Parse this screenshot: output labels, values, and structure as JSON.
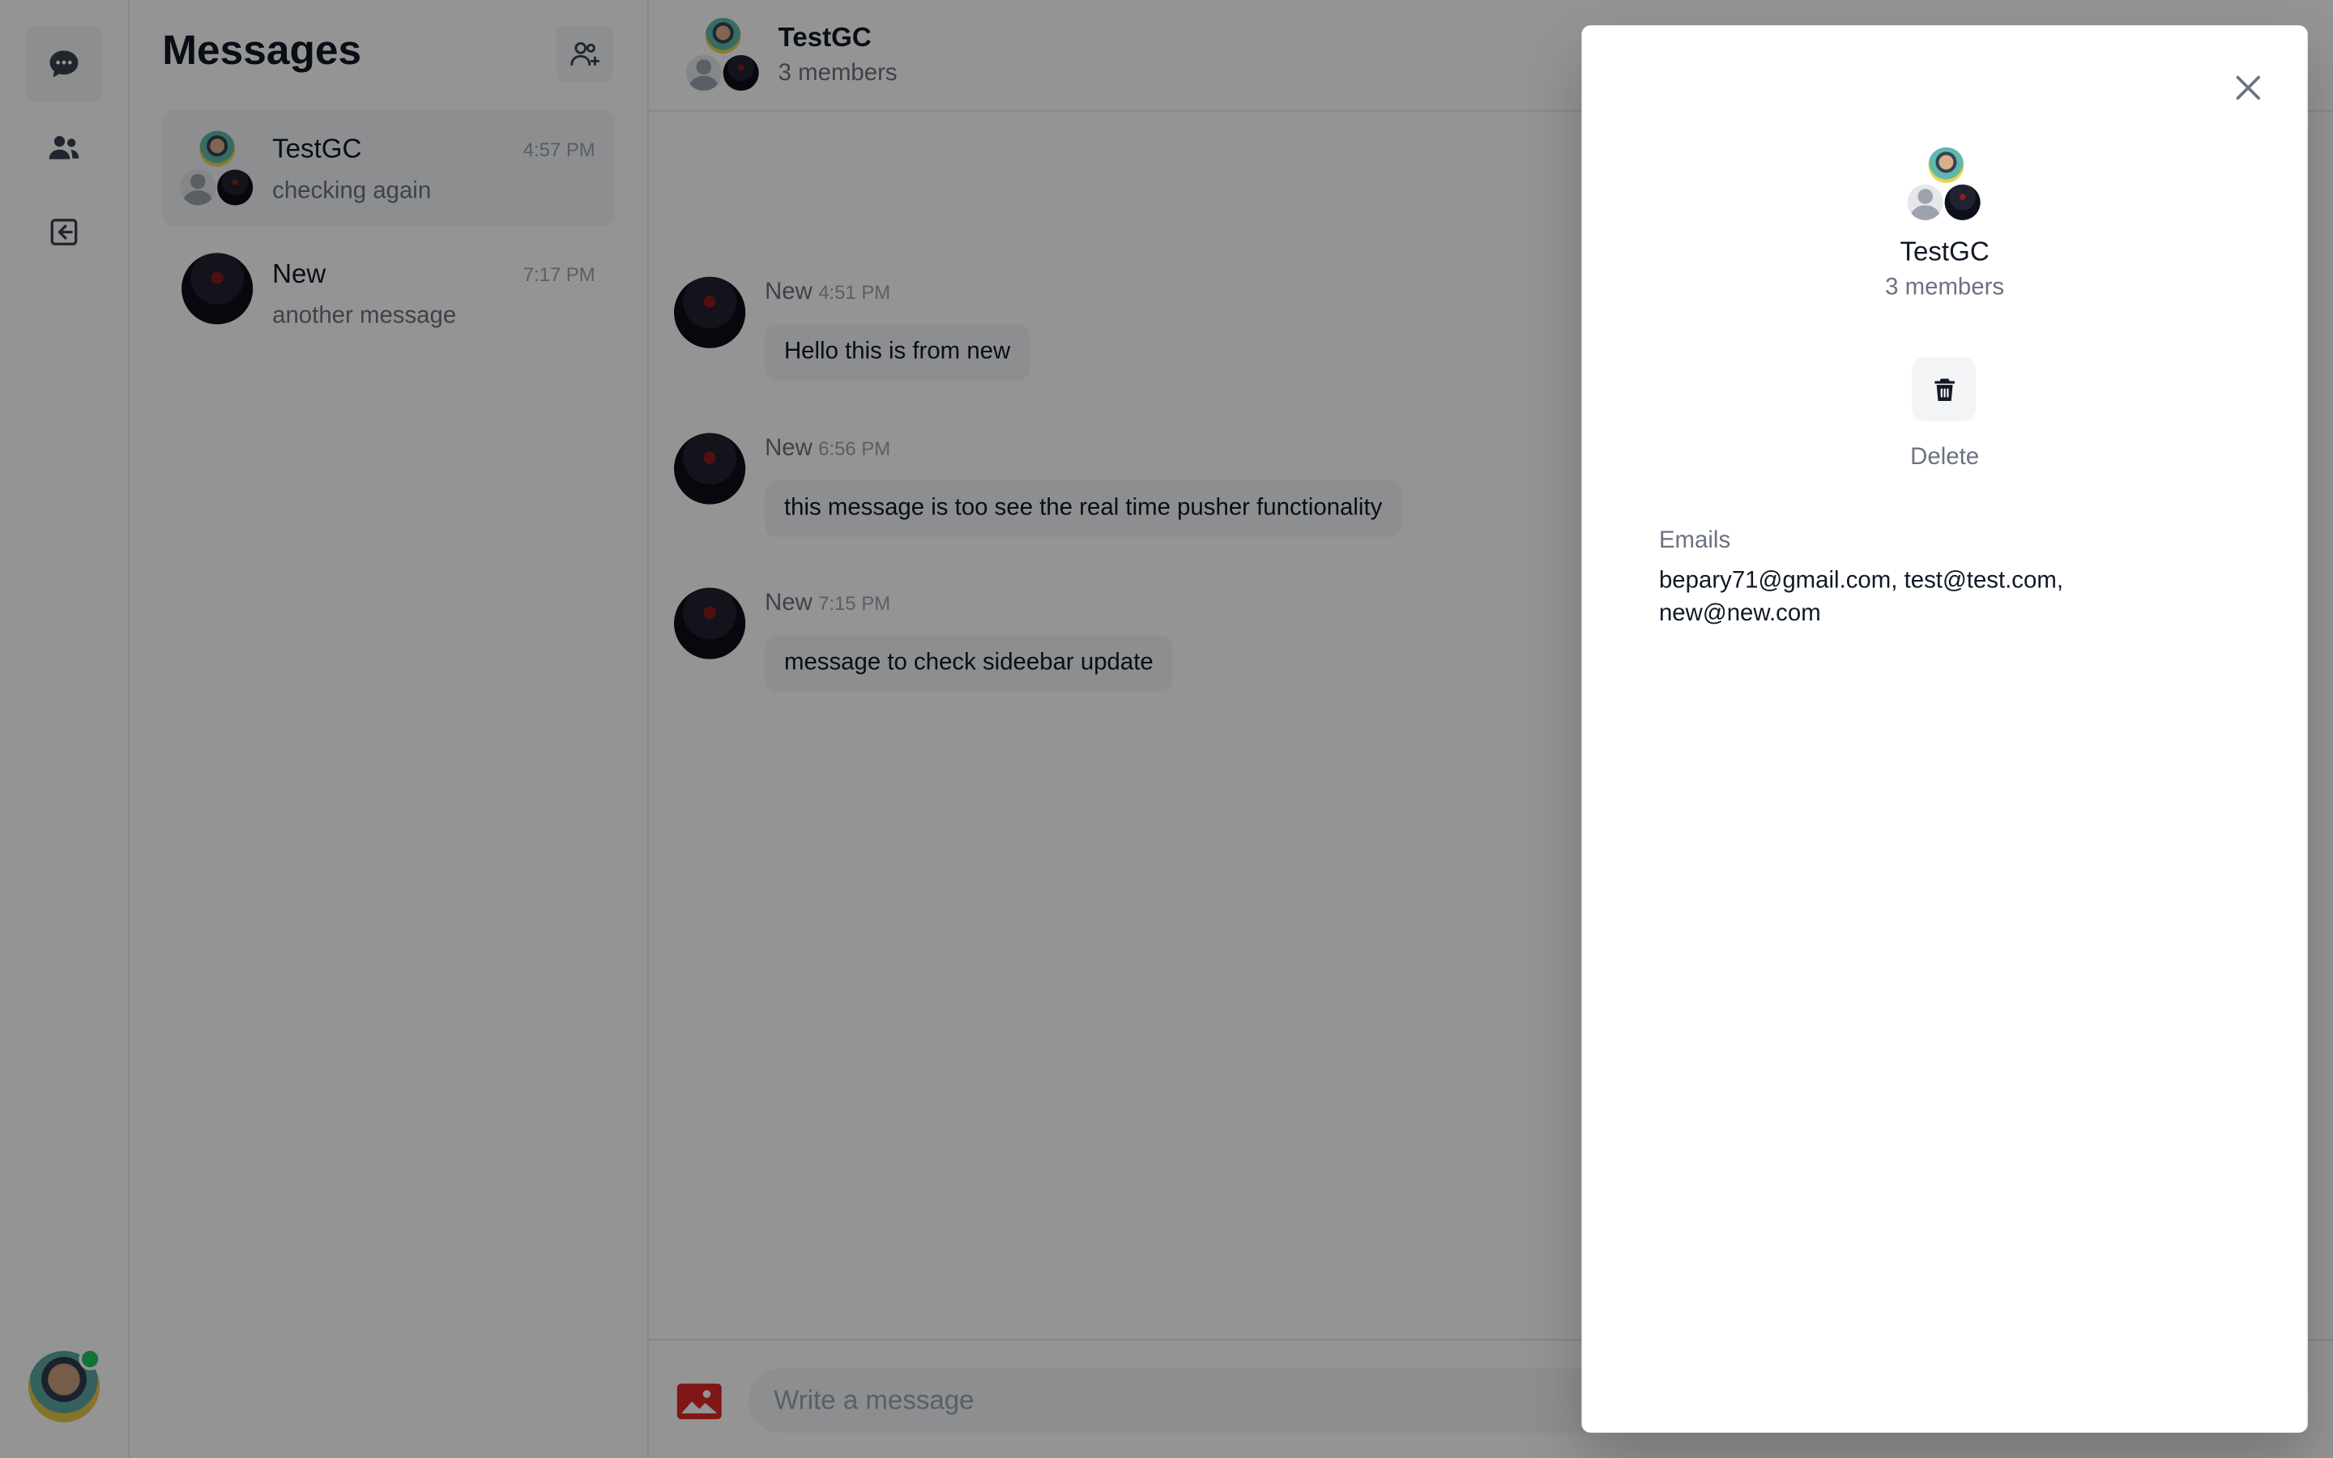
{
  "sidebar": {
    "icons": [
      "chat-bubble-icon",
      "users-icon",
      "logout-icon"
    ]
  },
  "conversations": {
    "title": "Messages",
    "items": [
      {
        "name": "TestGC",
        "time": "4:57 PM",
        "last": "checking again",
        "group": true
      },
      {
        "name": "New",
        "time": "7:17 PM",
        "last": "another message",
        "group": false
      }
    ]
  },
  "chat": {
    "title": "TestGC",
    "subtitle": "3 members",
    "messages": [
      {
        "sender": "New",
        "time": "4:51 PM",
        "text": "Hello this is from new"
      },
      {
        "sender": "New",
        "time": "6:56 PM",
        "text": "this message is too see the real time pusher functionality"
      },
      {
        "sender": "New",
        "time": "7:15 PM",
        "text": "message to check sideebar update"
      }
    ],
    "composer_placeholder": "Write a message"
  },
  "drawer": {
    "title": "TestGC",
    "subtitle": "3 members",
    "delete_label": "Delete",
    "emails_label": "Emails",
    "emails_value": "bepary71@gmail.com, test@test.com, new@new.com"
  },
  "colors": {
    "accent": "#22c55e",
    "image_icon": "#dc2626",
    "overlay": "rgba(0,0,0,0.42)"
  }
}
